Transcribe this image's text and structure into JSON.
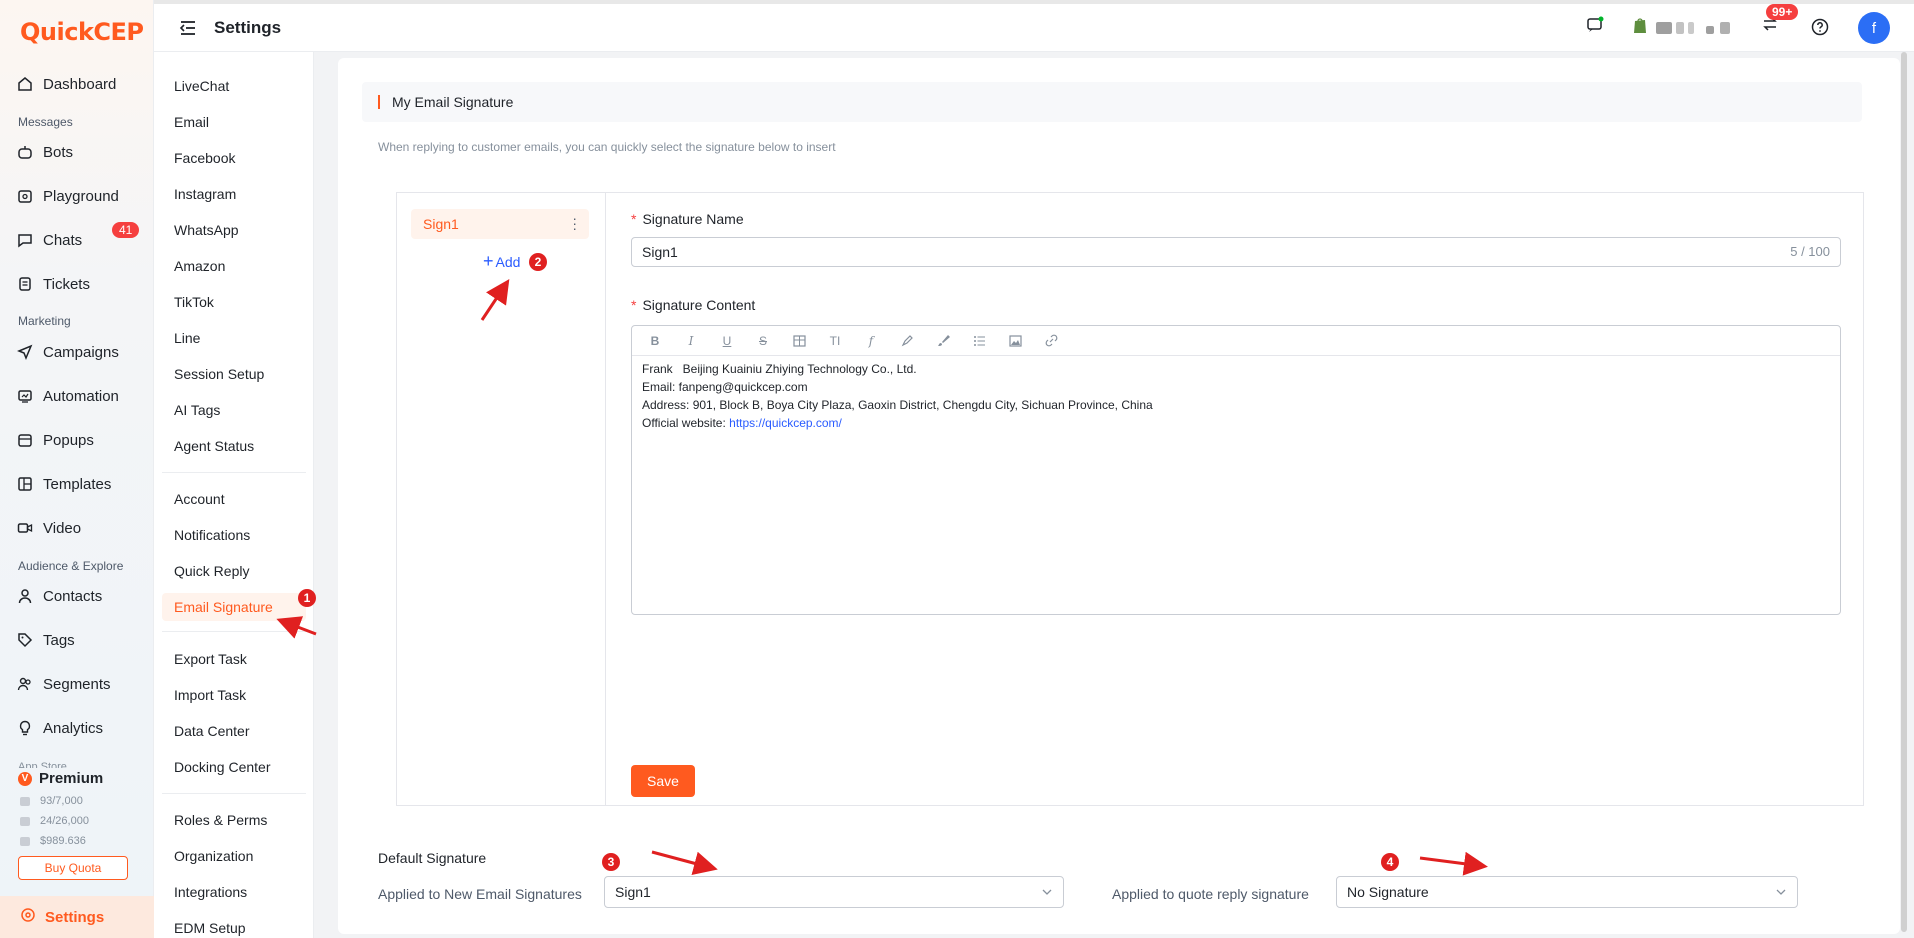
{
  "app": {
    "logo": "QuickCEP"
  },
  "header": {
    "title": "Settings",
    "notifications_badge": "99+",
    "avatar_initial": "f"
  },
  "leftnav": {
    "items": [
      {
        "label": "Dashboard"
      },
      {
        "label": "Bots"
      },
      {
        "label": "Playground"
      },
      {
        "label": "Chats",
        "badge": "41"
      },
      {
        "label": "Tickets"
      },
      {
        "label": "Campaigns"
      },
      {
        "label": "Automation"
      },
      {
        "label": "Popups"
      },
      {
        "label": "Templates"
      },
      {
        "label": "Video"
      },
      {
        "label": "Contacts"
      },
      {
        "label": "Tags"
      },
      {
        "label": "Segments"
      },
      {
        "label": "Analytics"
      }
    ],
    "sections": {
      "messages": "Messages",
      "marketing": "Marketing",
      "audience": "Audience & Explore",
      "appstore": "App Store"
    },
    "plan": {
      "name": "Premium",
      "quota1": "93/7,000",
      "quota2": "24/26,000",
      "balance": "$989.636",
      "buy_label": "Buy Quota"
    },
    "settings_label": "Settings"
  },
  "subnav": {
    "group1": [
      "LiveChat",
      "Email",
      "Facebook",
      "Instagram",
      "WhatsApp",
      "Amazon",
      "TikTok",
      "Line",
      "Session Setup",
      "AI Tags",
      "Agent Status"
    ],
    "group2": [
      "Account",
      "Notifications",
      "Quick Reply",
      "Email Signature"
    ],
    "group3": [
      "Export Task",
      "Import Task",
      "Data Center",
      "Docking Center"
    ],
    "group4": [
      "Roles & Perms",
      "Organization",
      "Integrations",
      "EDM Setup"
    ],
    "active": "Email Signature"
  },
  "main": {
    "section_title": "My Email Signature",
    "description": "When replying to customer emails, you can quickly select the signature below to insert",
    "signatures": [
      {
        "name": "Sign1"
      }
    ],
    "add_label": "Add",
    "form": {
      "name_label": "Signature Name",
      "name_value": "Sign1",
      "name_count": "5 / 100",
      "content_label": "Signature Content",
      "content_lines": [
        "Frank   Beijing Kuainiu Zhiying Technology Co., Ltd.",
        "Email: fanpeng@quickcep.com",
        "Address: 901, Block B, Boya City Plaza, Gaoxin District, Chengdu City, Sichuan Province, China",
        "Official website: "
      ],
      "website_link": "https://quickcep.com/",
      "save_label": "Save"
    },
    "default": {
      "title": "Default Signature",
      "new_label": "Applied to New Email Signatures",
      "new_value": "Sign1",
      "reply_label": "Applied to quote reply signature",
      "reply_value": "No Signature"
    }
  },
  "annotations": [
    "1",
    "2",
    "3",
    "4"
  ],
  "colors": {
    "brand": "#ff5a1f",
    "link": "#2b5cff",
    "annotation": "#e02020"
  }
}
